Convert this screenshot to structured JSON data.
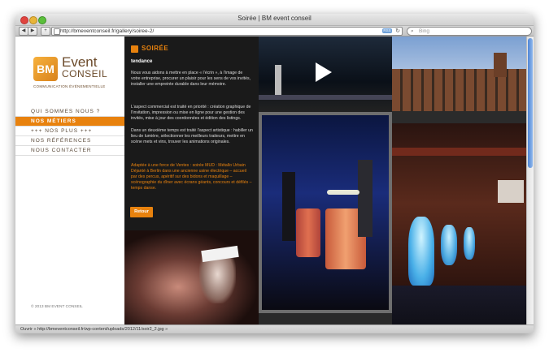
{
  "window": {
    "title": "Soirée | BM event conseil"
  },
  "toolbar": {
    "back_icon": "back-arrow-icon",
    "forward_icon": "forward-arrow-icon",
    "add_icon": "plus-icon",
    "url": "http://bmeventconseil.fr/gallery/soiree-2/",
    "rss_label": "RSS",
    "search_placeholder": "Bing"
  },
  "logo": {
    "mark": "BM",
    "event": "Event",
    "conseil": "CONSEIL",
    "subtitle": "COMMUNICATION ÉVÉNEMENTIELLE"
  },
  "menu": {
    "items": [
      {
        "label": "QUI SOMMES NOUS ?"
      },
      {
        "label": "NOS MÉTIERS"
      },
      {
        "label": "+++ NOS PLUS +++"
      },
      {
        "label": "NOS RÉFÉRENCES"
      },
      {
        "label": "NOUS CONTACTER"
      }
    ]
  },
  "footer": {
    "copyright": "© 2013 BM EVENT CONSEIL"
  },
  "article": {
    "title": "SOIRÉE",
    "subtitle": "tendance",
    "p1": "Nous vous aidons à mettre en place « l’écrin », à l’image de votre entreprise, procurer un plaisir pour les sens de vos invités, installer une empreinte durable dans leur mémoire.",
    "p2": "L’aspect commercial est traité en priorité : création graphique de l’invitation, impression ou mise en ligne pour une gestion des invités, mise à jour des coordonnées et édition des listings.",
    "p3": "Dans un deuxième temps est traité l’aspect artistique : habiller un lieu de lumière, sélectionner les meilleurs traiteurs, mettre en scène mets et vins, trouver les animations originales.",
    "p4": "Adaptée à une force de Ventes : soirée MUD : Métallo Urbain Déjanté à Berlin dans une ancienne usine électrique – accueil par des percus, apéritif sur des bidons et maquillage – scénographie du dîner avec écrans géants, concours et défilés – temps danse.",
    "back_button": "Retour"
  },
  "status": {
    "text": "Ouvrir « http://bmeventconseil.fr/wp-content/uploads/2012/11/soir2_2.jpg »"
  }
}
